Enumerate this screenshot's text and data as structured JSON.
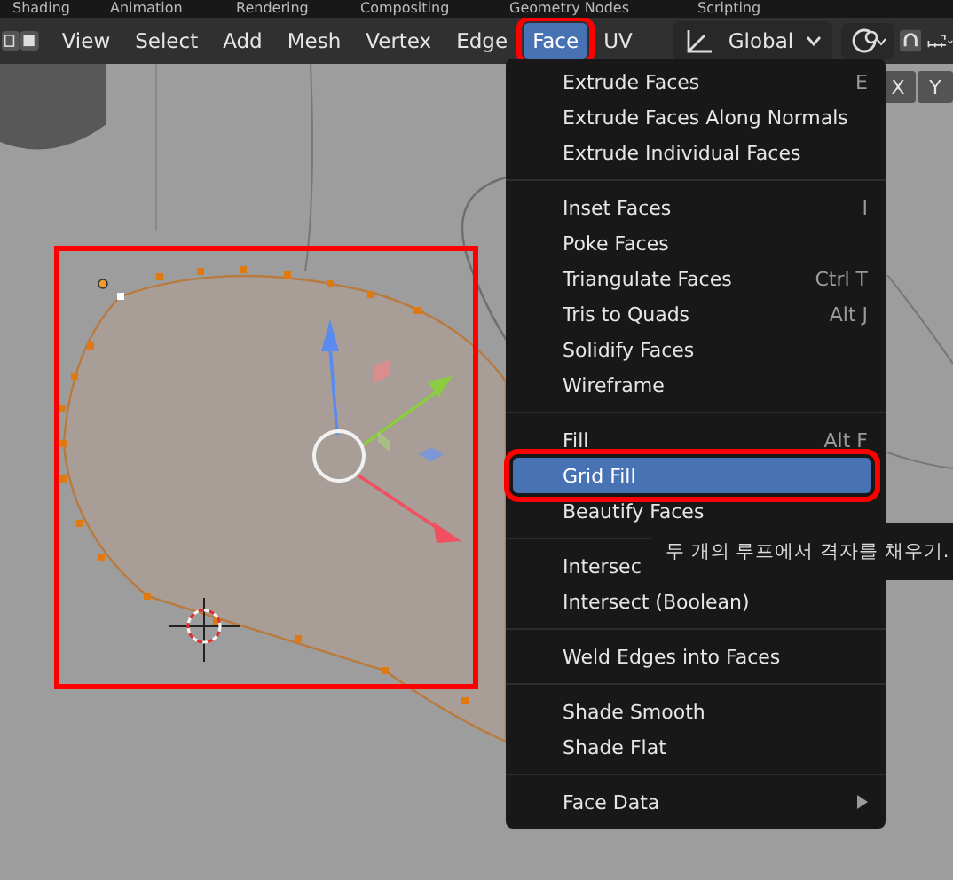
{
  "workspace_tabs": [
    {
      "label": "Shading"
    },
    {
      "label": "Animation"
    },
    {
      "label": "Rendering"
    },
    {
      "label": "Compositing"
    },
    {
      "label": "Geometry Nodes"
    },
    {
      "label": "Scripting"
    }
  ],
  "header": {
    "menus": [
      {
        "label": "View",
        "selected": false
      },
      {
        "label": "Select",
        "selected": false
      },
      {
        "label": "Add",
        "selected": false
      },
      {
        "label": "Mesh",
        "selected": false
      },
      {
        "label": "Vertex",
        "selected": false
      },
      {
        "label": "Edge",
        "selected": false
      },
      {
        "label": "Face",
        "selected": true
      },
      {
        "label": "UV",
        "selected": false
      }
    ],
    "orientation": {
      "value": "Global"
    }
  },
  "axis_buttons": [
    "X",
    "Y"
  ],
  "face_menu": {
    "sections": [
      [
        {
          "label": "Extrude Faces",
          "shortcut": "E",
          "selected": false
        },
        {
          "label": "Extrude Faces Along Normals",
          "selected": false
        },
        {
          "label": "Extrude Individual Faces",
          "selected": false
        }
      ],
      [
        {
          "label": "Inset Faces",
          "shortcut": "I",
          "selected": false
        },
        {
          "label": "Poke Faces",
          "selected": false
        },
        {
          "label": "Triangulate Faces",
          "shortcut": "Ctrl T",
          "selected": false
        },
        {
          "label": "Tris to Quads",
          "shortcut": "Alt J",
          "selected": false
        },
        {
          "label": "Solidify Faces",
          "selected": false
        },
        {
          "label": "Wireframe",
          "selected": false
        }
      ],
      [
        {
          "label": "Fill",
          "shortcut": "Alt F",
          "selected": false
        },
        {
          "label": "Grid Fill",
          "selected": true
        },
        {
          "label": "Beautify Faces",
          "selected": false
        }
      ],
      [
        {
          "label": "Intersec",
          "selected": false
        },
        {
          "label": "Intersect (Boolean)",
          "selected": false
        }
      ],
      [
        {
          "label": "Weld Edges into Faces",
          "selected": false
        }
      ],
      [
        {
          "label": "Shade Smooth",
          "selected": false
        },
        {
          "label": "Shade Flat",
          "selected": false
        }
      ],
      [
        {
          "label": "Face Data",
          "selected": false,
          "submenu": true
        }
      ]
    ]
  },
  "tooltip": {
    "text": "두 개의 루프에서 격자를 채우기."
  }
}
